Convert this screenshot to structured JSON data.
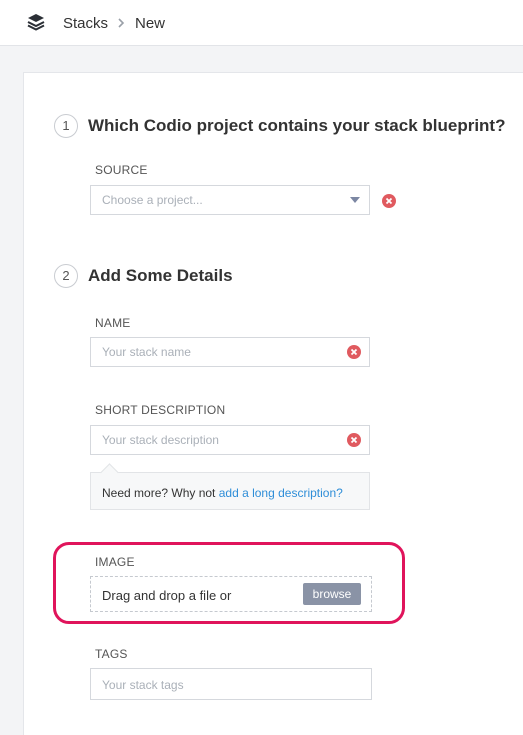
{
  "breadcrumb": {
    "root": "Stacks",
    "current": "New",
    "logo_icon": "stack-layers-icon",
    "separator_icon": "chevron-right-icon"
  },
  "step1": {
    "number": "1",
    "title": "Which Codio project contains your stack blueprint?",
    "source_label": "SOURCE",
    "source_placeholder": "Choose a project..."
  },
  "step2": {
    "number": "2",
    "title": "Add Some Details",
    "name_label": "NAME",
    "name_placeholder": "Your stack name",
    "short_desc_label": "SHORT DESCRIPTION",
    "short_desc_placeholder": "Your stack description",
    "hint_text": "Need more? Why not ",
    "hint_link": "add a long description?",
    "image_label": "IMAGE",
    "drop_text": "Drag and drop a file or",
    "browse_label": "browse",
    "tags_label": "TAGS",
    "tags_placeholder": "Your stack tags"
  },
  "colors": {
    "clear_icon": "#e05a5f",
    "link": "#2f8ed8",
    "browse_button": "#8a93a6",
    "highlight": "#e0145b"
  }
}
